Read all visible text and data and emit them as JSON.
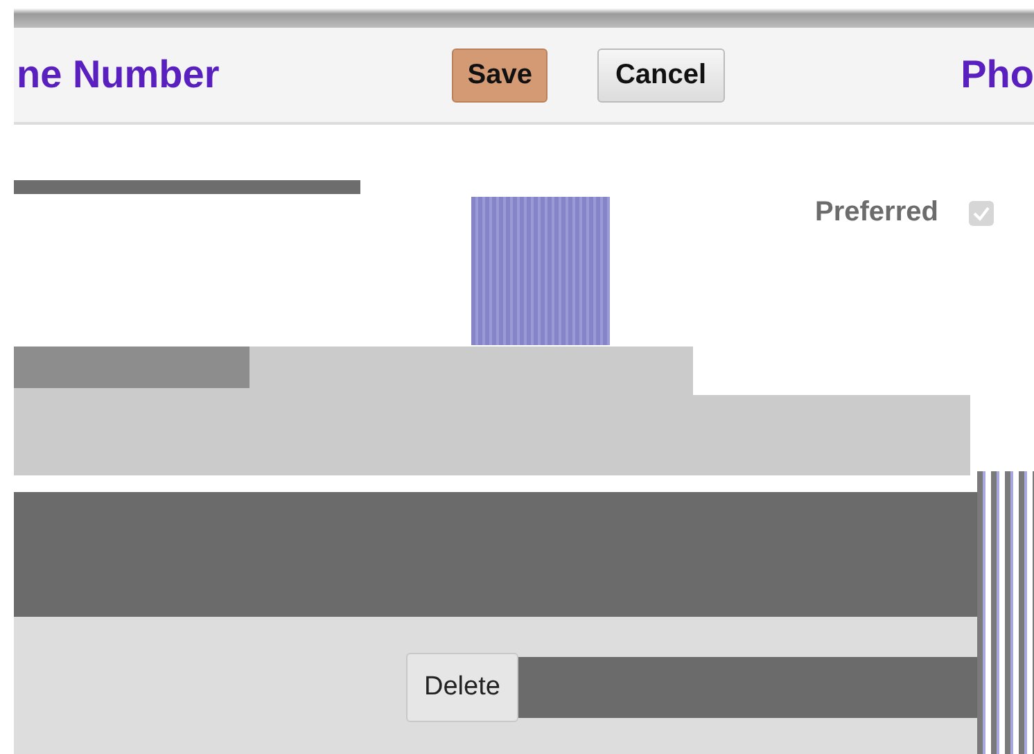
{
  "header": {
    "title": "ne Number",
    "title_right": "Pho"
  },
  "buttons": [
    {
      "label": "Save",
      "kind": "primary"
    },
    {
      "label": "Cancel",
      "kind": "secondary"
    }
  ],
  "preferred": {
    "label": "Preferred",
    "checked": true,
    "disabled": true
  },
  "delete_button": {
    "label": "Delete"
  }
}
